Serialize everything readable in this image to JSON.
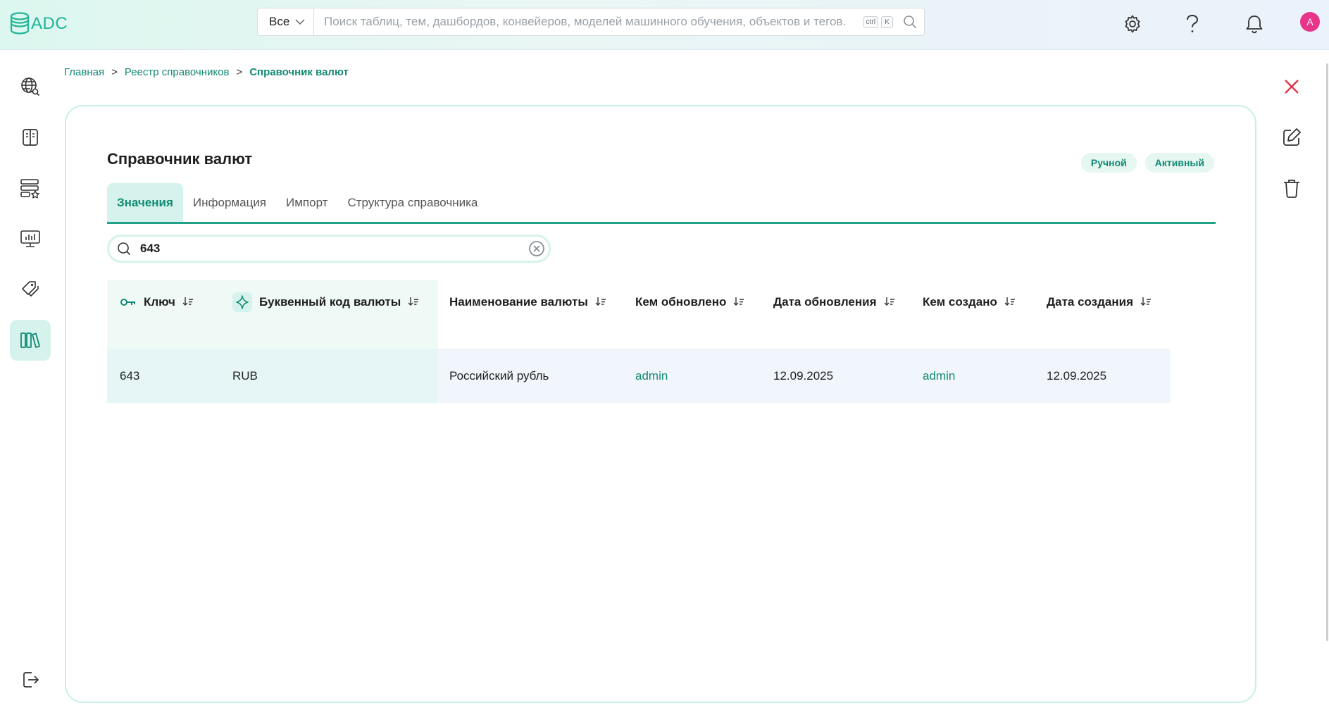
{
  "header": {
    "logo_text": "ADC",
    "search_scope": "Все",
    "search_placeholder": "Поиск таблиц, тем, дашбордов, конвейеров, моделей машинного обучения, объектов и тегов.",
    "shortcut_keys": [
      "ctrl",
      "K"
    ],
    "avatar_letter": "A",
    "icons": [
      "settings-icon",
      "help-icon",
      "notifications-icon"
    ]
  },
  "sidebar": {
    "items": [
      {
        "icon": "globe-search-icon"
      },
      {
        "icon": "book-icon"
      },
      {
        "icon": "database-star-icon"
      },
      {
        "icon": "monitor-chart-icon"
      },
      {
        "icon": "tags-icon"
      },
      {
        "icon": "library-icon",
        "active": true
      }
    ],
    "logout_icon": "logout-icon"
  },
  "breadcrumb": {
    "items": [
      "Главная",
      "Реестр справочников"
    ],
    "separator": ">",
    "current": "Справочник валют"
  },
  "page": {
    "title": "Справочник валют",
    "badges": [
      "Ручной",
      "Активный"
    ],
    "tabs": [
      {
        "label": "Значения",
        "active": true
      },
      {
        "label": "Информация"
      },
      {
        "label": "Импорт"
      },
      {
        "label": "Структура справочника"
      }
    ],
    "filter_value": "643"
  },
  "table": {
    "columns": [
      "Ключ",
      "Буквенный код валюты",
      "Наименование валюты",
      "Кем обновлено",
      "Дата обновления",
      "Кем создано",
      "Дата создания"
    ],
    "rows": [
      [
        "643",
        "RUB",
        "Российский рубль",
        "admin",
        "12.09.2025",
        "admin",
        "12.09.2025"
      ]
    ]
  },
  "actions": [
    "close-icon",
    "edit-icon",
    "delete-icon"
  ],
  "colors": {
    "accent": "#128a73",
    "accent_light": "#d5f3ec",
    "close_red": "#e0354b",
    "avatar": "#e8348a"
  }
}
